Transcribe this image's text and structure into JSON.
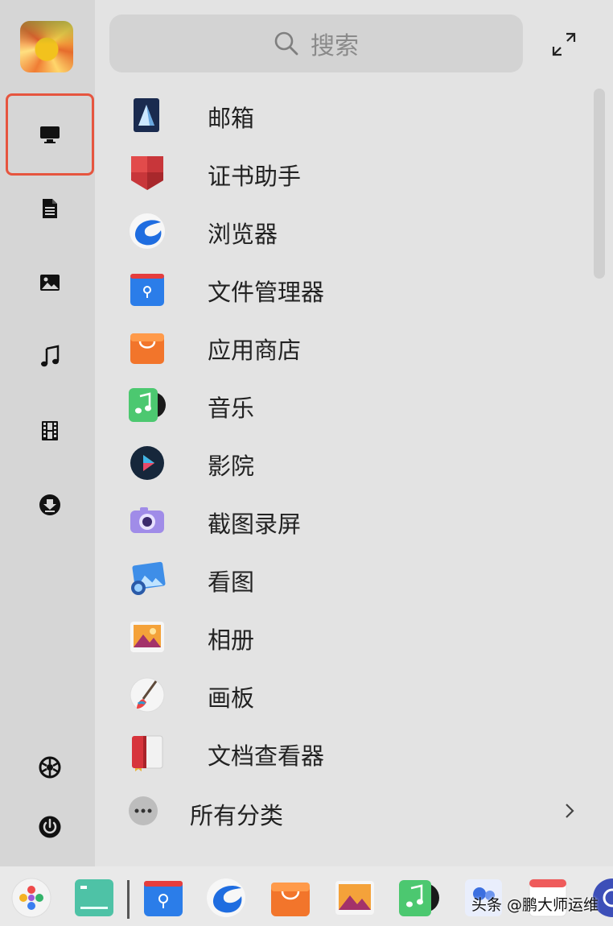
{
  "search": {
    "placeholder": "搜索"
  },
  "sidebar": {
    "items": [
      {
        "icon": "computer-icon",
        "selected": true
      },
      {
        "icon": "document-icon"
      },
      {
        "icon": "picture-icon"
      },
      {
        "icon": "music-icon"
      },
      {
        "icon": "video-icon"
      },
      {
        "icon": "download-icon"
      },
      {
        "icon": "settings-icon"
      },
      {
        "icon": "power-icon"
      }
    ],
    "selection_outline_color": "#e6553f"
  },
  "apps": [
    {
      "label": "邮箱",
      "icon": "mail-icon"
    },
    {
      "label": "证书助手",
      "icon": "certificate-icon"
    },
    {
      "label": "浏览器",
      "icon": "browser-icon"
    },
    {
      "label": "文件管理器",
      "icon": "file-manager-icon"
    },
    {
      "label": "应用商店",
      "icon": "app-store-icon"
    },
    {
      "label": "音乐",
      "icon": "music-app-icon"
    },
    {
      "label": "影院",
      "icon": "movie-icon"
    },
    {
      "label": "截图录屏",
      "icon": "screenshot-icon"
    },
    {
      "label": "看图",
      "icon": "image-viewer-icon"
    },
    {
      "label": "相册",
      "icon": "album-icon"
    },
    {
      "label": "画板",
      "icon": "draw-icon"
    },
    {
      "label": "文档查看器",
      "icon": "document-viewer-icon"
    }
  ],
  "all_categories": {
    "label": "所有分类"
  },
  "dock": {
    "items": [
      "launcher-icon",
      "multitask-view-icon",
      "file-manager-icon",
      "browser-icon",
      "app-store-icon",
      "album-icon",
      "music-app-icon",
      "contacts-icon",
      "calendar-icon",
      "settings-icon"
    ]
  },
  "watermark": "头条 @鹏大师运维"
}
